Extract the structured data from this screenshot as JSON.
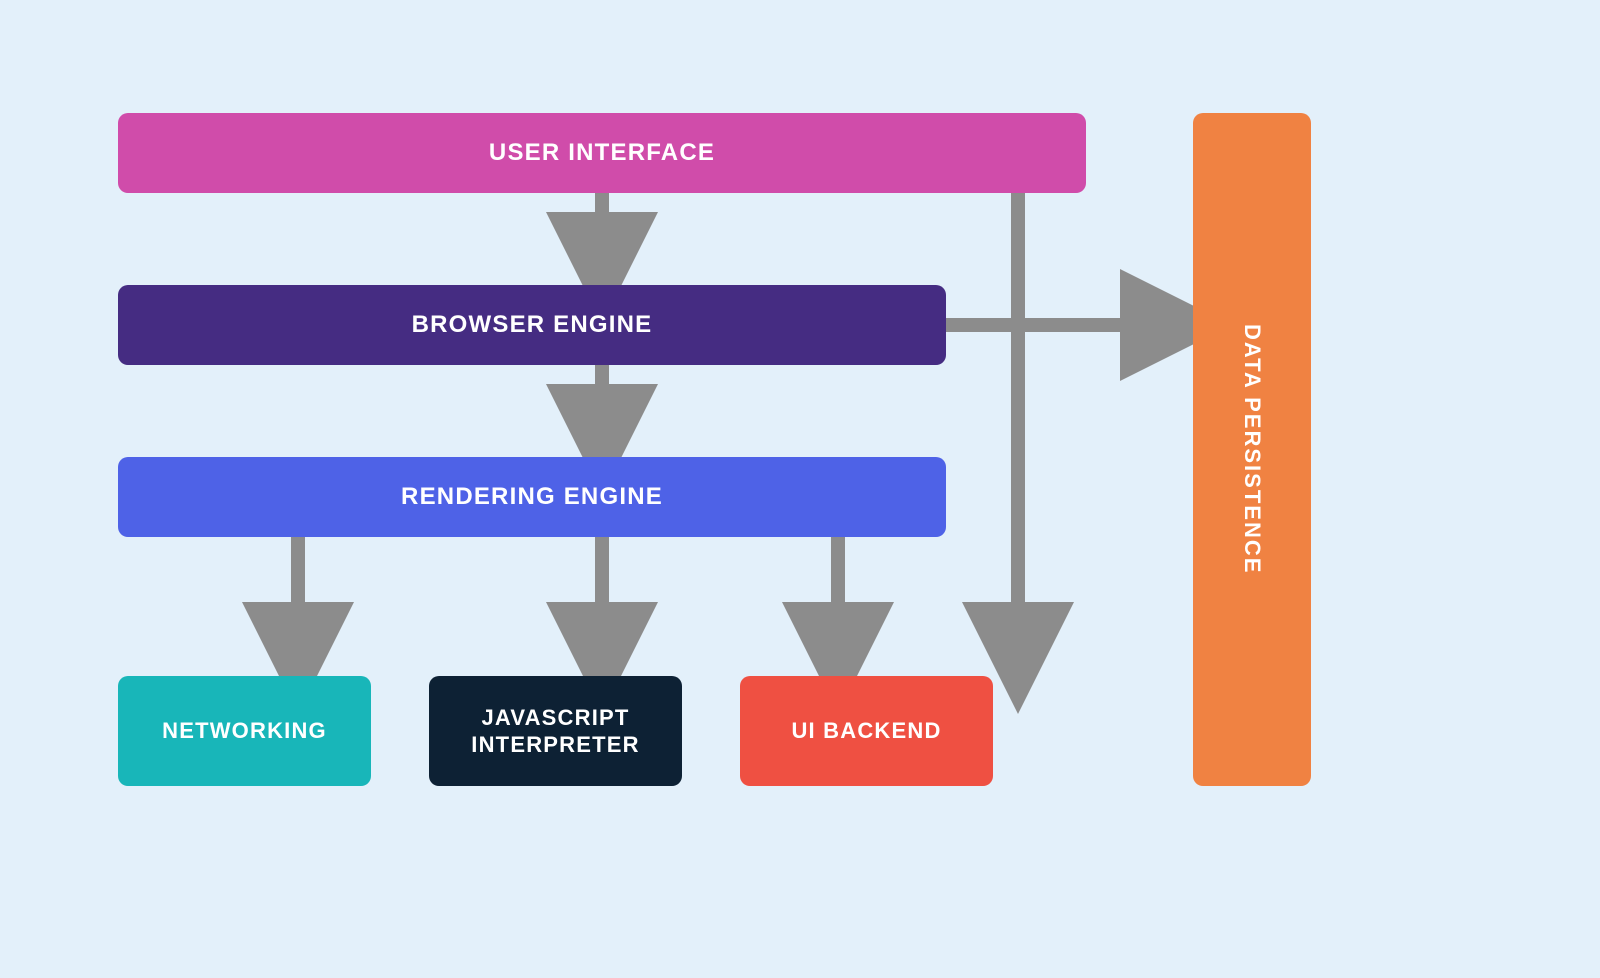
{
  "nodes": {
    "user_interface": "USER INTERFACE",
    "browser_engine": "BROWSER ENGINE",
    "rendering_engine": "RENDERING ENGINE",
    "networking": "NETWORKING",
    "javascript_interpreter": "JAVASCRIPT INTERPRETER",
    "ui_backend": "UI BACKEND",
    "data_persistence": "DATA PERSISTENCE"
  },
  "colors": {
    "background": "#e3f0fa",
    "user_interface": "#d04caa",
    "browser_engine": "#452c82",
    "rendering_engine": "#4e62e7",
    "networking": "#18b6b9",
    "javascript_interpreter": "#0d2134",
    "ui_backend": "#ef5042",
    "data_persistence": "#f08242",
    "arrow": "#8c8c8c"
  },
  "edges": [
    {
      "from": "user_interface",
      "to": "browser_engine"
    },
    {
      "from": "browser_engine",
      "to": "rendering_engine"
    },
    {
      "from": "rendering_engine",
      "to": "networking"
    },
    {
      "from": "rendering_engine",
      "to": "javascript_interpreter"
    },
    {
      "from": "rendering_engine",
      "to": "ui_backend"
    },
    {
      "from": "user_interface",
      "to": "ui_backend"
    },
    {
      "from": "browser_engine",
      "to": "data_persistence"
    }
  ]
}
